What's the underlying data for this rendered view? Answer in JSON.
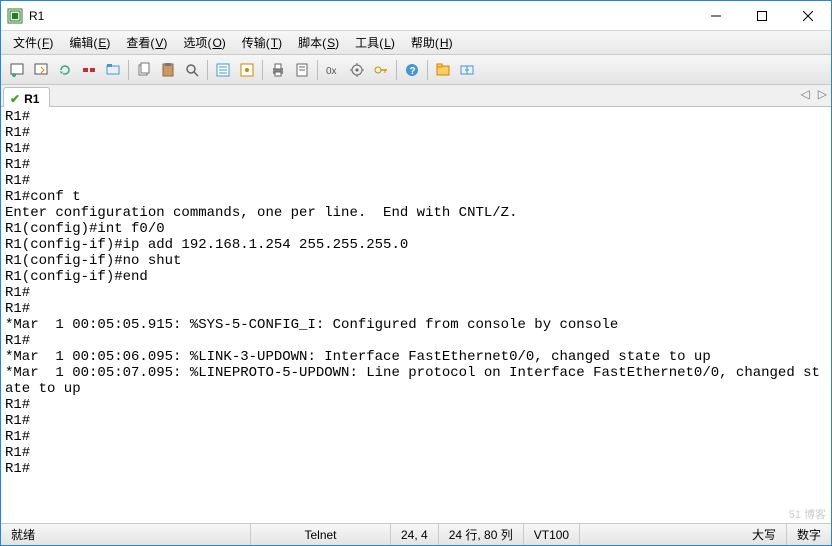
{
  "window": {
    "title": "R1"
  },
  "menu": {
    "file": {
      "label": "文件",
      "key": "F"
    },
    "edit": {
      "label": "编辑",
      "key": "E"
    },
    "view": {
      "label": "查看",
      "key": "V"
    },
    "options": {
      "label": "选项",
      "key": "O"
    },
    "transfer": {
      "label": "传输",
      "key": "T"
    },
    "script": {
      "label": "脚本",
      "key": "S"
    },
    "tools": {
      "label": "工具",
      "key": "L"
    },
    "help": {
      "label": "帮助",
      "key": "H"
    }
  },
  "tab": {
    "label": "R1"
  },
  "terminal_lines": [
    "R1#",
    "R1#",
    "R1#",
    "R1#",
    "R1#",
    "R1#conf t",
    "Enter configuration commands, one per line.  End with CNTL/Z.",
    "R1(config)#int f0/0",
    "R1(config-if)#ip add 192.168.1.254 255.255.255.0",
    "R1(config-if)#no shut",
    "R1(config-if)#end",
    "R1#",
    "R1#",
    "*Mar  1 00:05:05.915: %SYS-5-CONFIG_I: Configured from console by console",
    "R1#",
    "*Mar  1 00:05:06.095: %LINK-3-UPDOWN: Interface FastEthernet0/0, changed state to up",
    "*Mar  1 00:05:07.095: %LINEPROTO-5-UPDOWN: Line protocol on Interface FastEthernet0/0, changed state to up",
    "R1#",
    "R1#",
    "R1#",
    "R1#",
    "R1#"
  ],
  "status": {
    "ready": "就绪",
    "protocol": "Telnet",
    "cursor": "24,  4",
    "dims": "24 行, 80 列",
    "emulation": "VT100",
    "caps": "大写",
    "num": "数字"
  },
  "watermark": "51 博客"
}
